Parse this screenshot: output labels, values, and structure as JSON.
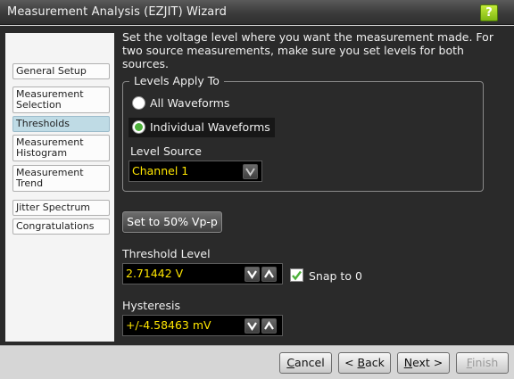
{
  "window": {
    "title": "Measurement Analysis (EZJIT) Wizard",
    "help_label": "?"
  },
  "sidebar": {
    "items": [
      {
        "label": "General Setup",
        "active": false
      },
      {
        "label": "Measurement Selection",
        "active": false
      },
      {
        "label": "Thresholds",
        "active": true
      },
      {
        "label": "Measurement Histogram",
        "active": false
      },
      {
        "label": "Measurement Trend",
        "active": false
      },
      {
        "label": "Jitter Spectrum",
        "active": false
      },
      {
        "label": "Congratulations",
        "active": false
      }
    ]
  },
  "content": {
    "description": "Set the voltage level where you want the measurement made. For two source measurements, make sure you set levels for both sources.",
    "levels_group": {
      "legend": "Levels Apply To",
      "options": [
        {
          "label": "All Waveforms",
          "selected": false
        },
        {
          "label": "Individual Waveforms",
          "selected": true
        }
      ],
      "level_source_label": "Level Source",
      "level_source_value": "Channel 1"
    },
    "set_50_button": "Set to 50% Vp-p",
    "threshold": {
      "label": "Threshold Level",
      "value": "2.71442 V",
      "snap_label": "Snap to 0",
      "snap_checked": true
    },
    "hysteresis": {
      "label": "Hysteresis",
      "value": "+/-4.58463 mV"
    }
  },
  "footer": {
    "cancel": {
      "prefix": "",
      "accel": "C",
      "suffix": "ancel"
    },
    "back": {
      "prefix": "< ",
      "accel": "B",
      "suffix": "ack"
    },
    "next": {
      "prefix": "",
      "accel": "N",
      "suffix": "ext >"
    },
    "finish": {
      "prefix": "",
      "accel": "F",
      "suffix": "inish",
      "disabled": true
    }
  },
  "colors": {
    "accent_green": "#7fb813",
    "value_yellow": "#ffe600",
    "selected_nav": "#bfdbe5"
  }
}
